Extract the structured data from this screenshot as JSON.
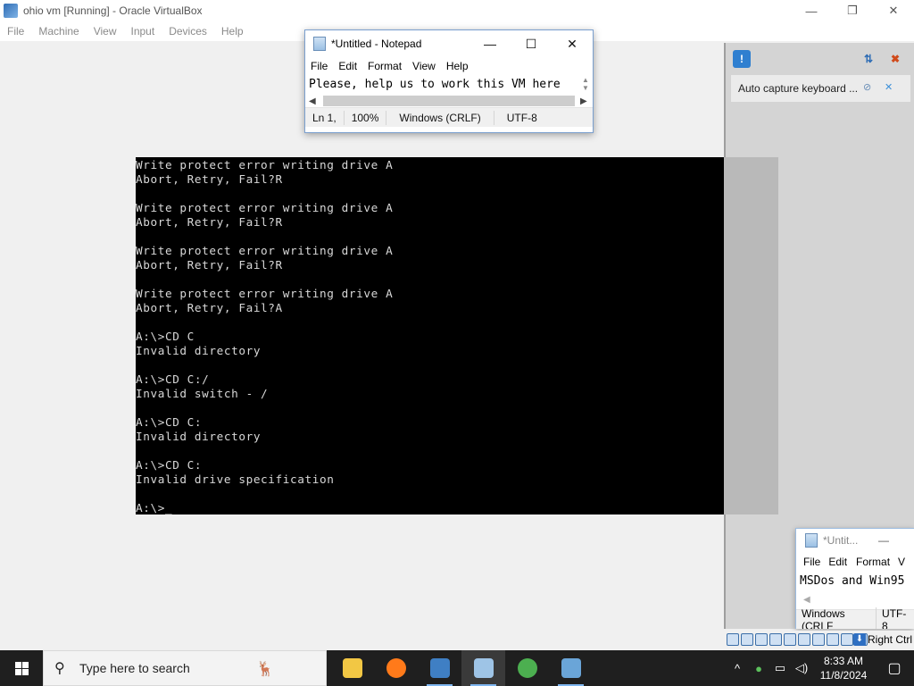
{
  "vbox": {
    "title": "ohio vm [Running] - Oracle VirtualBox",
    "menu": [
      "File",
      "Machine",
      "View",
      "Input",
      "Devices",
      "Help"
    ],
    "window_controls": {
      "minimize": "—",
      "restore": "❐",
      "close": "✕"
    }
  },
  "dos": {
    "lines": [
      "Write protect error writing drive A",
      "Abort, Retry, Fail?R",
      "",
      "Write protect error writing drive A",
      "Abort, Retry, Fail?R",
      "",
      "Write protect error writing drive A",
      "Abort, Retry, Fail?R",
      "",
      "Write protect error writing drive A",
      "Abort, Retry, Fail?A",
      "",
      "A:\\>CD C",
      "Invalid directory",
      "",
      "A:\\>CD C:/",
      "Invalid switch - /",
      "",
      "A:\\>CD C:",
      "Invalid directory",
      "",
      "A:\\>CD C:",
      "Invalid drive specification",
      "",
      "A:\\>_"
    ]
  },
  "side_panel": {
    "notification": "Auto capture keyboard ..."
  },
  "notepad": {
    "title": "*Untitled - Notepad",
    "menu": [
      "File",
      "Edit",
      "Format",
      "View",
      "Help"
    ],
    "text": "Please, help us to work this VM here",
    "status": {
      "position": "Ln 1,",
      "zoom": "100%",
      "line_ending": "Windows (CRLF)",
      "encoding": "UTF-8"
    }
  },
  "notepad2": {
    "title": "*Untit...",
    "menu": [
      "File",
      "Edit",
      "Format",
      "V"
    ],
    "text": "MSDos and Win95",
    "status": {
      "line_ending": "Windows (CRLF",
      "encoding": "UTF-8"
    }
  },
  "vbox_status": {
    "host_key": "Right Ctrl"
  },
  "taskbar": {
    "search_placeholder": "Type here to search",
    "clock_time": "8:33 AM",
    "clock_date": "11/8/2024",
    "apps": [
      {
        "name": "file-explorer",
        "color": "#f2c744"
      },
      {
        "name": "firefox",
        "color": "#ff7a1a"
      },
      {
        "name": "virtualbox",
        "color": "#3f7fc4"
      },
      {
        "name": "notepad",
        "color": "#9ec4e6"
      },
      {
        "name": "people-app",
        "color": "#4caf50"
      },
      {
        "name": "virtualbox-x64",
        "color": "#6aa5d8"
      }
    ]
  }
}
